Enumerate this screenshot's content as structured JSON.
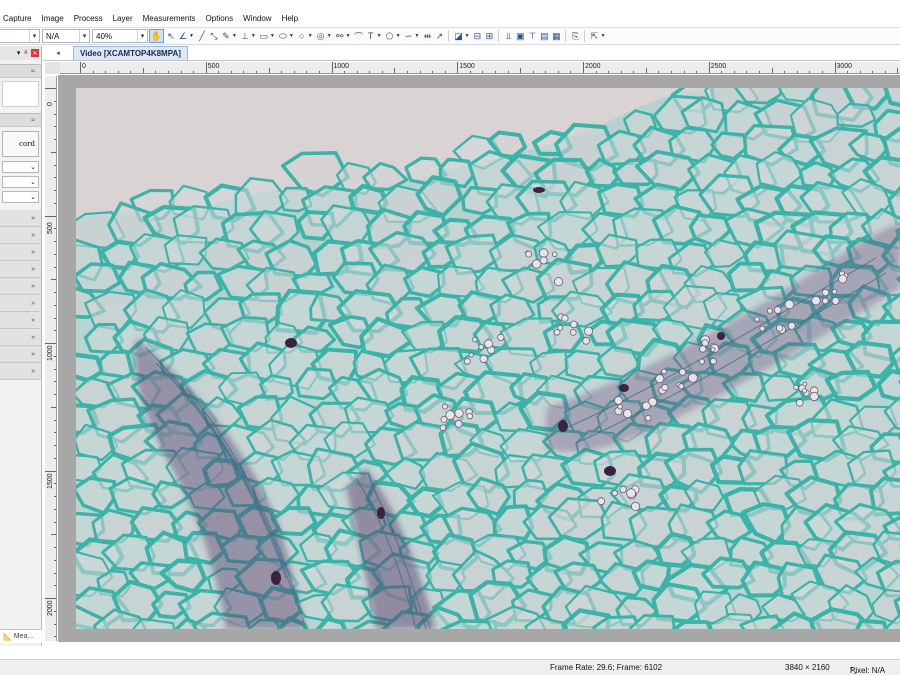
{
  "menu": [
    "Capture",
    "Image",
    "Process",
    "Layer",
    "Measurements",
    "Options",
    "Window",
    "Help"
  ],
  "toolbar": {
    "mode_value": "N/A",
    "zoom_value": "40%"
  },
  "left_panel": {
    "record_label": "cord",
    "bottom_tab_label": "Mea..."
  },
  "document": {
    "tab_title": "Video [XCAMTOP4K8MPA]",
    "h_ruler_labels": [
      "0",
      "500",
      "1000",
      "1500",
      "2000",
      "2500",
      "3000"
    ],
    "v_ruler_labels": [
      "0",
      "500",
      "1000",
      "1500",
      "2000"
    ]
  },
  "status": {
    "frame_info": "Frame Rate: 29.6; Frame: 6102",
    "resolution": "3840 × 2160",
    "pixel": "Pixel: N/A"
  },
  "colors": {
    "stain_cyan": "#3bb3a8",
    "stain_purple": "#5a3f6e",
    "slide_background": "#d9d3d4",
    "active_tab": "#dce8f7"
  }
}
